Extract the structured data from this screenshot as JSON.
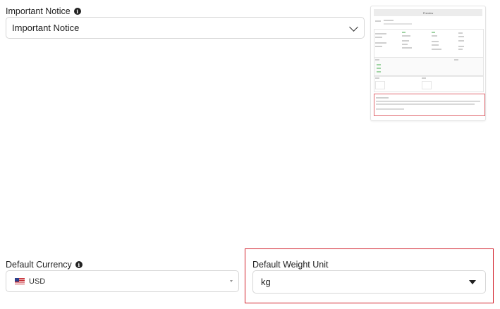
{
  "notice": {
    "label": "Important Notice",
    "info_icon": "info-icon",
    "selected": "Important Notice",
    "chevron_icon": "chevron-down-icon"
  },
  "preview": {
    "title": "Preview"
  },
  "currency": {
    "label": "Default Currency",
    "info_icon": "info-icon",
    "flag_icon": "us-flag-icon",
    "selected": "USD"
  },
  "weight": {
    "label": "Default Weight Unit",
    "selected": "kg",
    "highlight_color": "#d21f2a"
  }
}
